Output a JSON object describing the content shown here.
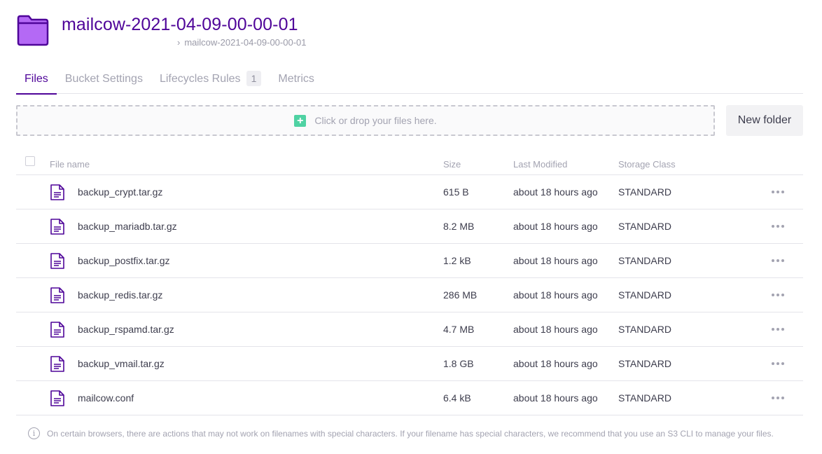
{
  "header": {
    "title": "mailcow-2021-04-09-00-00-01",
    "breadcrumb": "mailcow-2021-04-09-00-00-01",
    "breadcrumb_separator": "›",
    "folder_icon": "folder-icon",
    "folder_color": "#b469f5"
  },
  "tabs": [
    {
      "label": "Files",
      "active": true
    },
    {
      "label": "Bucket Settings",
      "active": false
    },
    {
      "label": "Lifecycles Rules",
      "badge": "1",
      "active": false
    },
    {
      "label": "Metrics",
      "active": false
    }
  ],
  "upload": {
    "prompt": "Click or drop your files here.",
    "icon": "plus-icon"
  },
  "new_folder_label": "New folder",
  "table": {
    "columns": [
      "File name",
      "Size",
      "Last Modified",
      "Storage Class"
    ],
    "rows": [
      {
        "name": "backup_crypt.tar.gz",
        "size": "615 B",
        "modified": "about 18 hours ago",
        "class": "STANDARD"
      },
      {
        "name": "backup_mariadb.tar.gz",
        "size": "8.2 MB",
        "modified": "about 18 hours ago",
        "class": "STANDARD"
      },
      {
        "name": "backup_postfix.tar.gz",
        "size": "1.2 kB",
        "modified": "about 18 hours ago",
        "class": "STANDARD"
      },
      {
        "name": "backup_redis.tar.gz",
        "size": "286 MB",
        "modified": "about 18 hours ago",
        "class": "STANDARD"
      },
      {
        "name": "backup_rspamd.tar.gz",
        "size": "4.7 MB",
        "modified": "about 18 hours ago",
        "class": "STANDARD"
      },
      {
        "name": "backup_vmail.tar.gz",
        "size": "1.8 GB",
        "modified": "about 18 hours ago",
        "class": "STANDARD"
      },
      {
        "name": "mailcow.conf",
        "size": "6.4 kB",
        "modified": "about 18 hours ago",
        "class": "STANDARD"
      }
    ]
  },
  "footer_note": "On certain browsers, there are actions that may not work on filenames with special characters. If your filename has special characters, we recommend that you use an S3 CLI to manage your files.",
  "colors": {
    "accent": "#4f0599",
    "folder": "#b469f5",
    "upload_icon": "#4fd2a3"
  }
}
